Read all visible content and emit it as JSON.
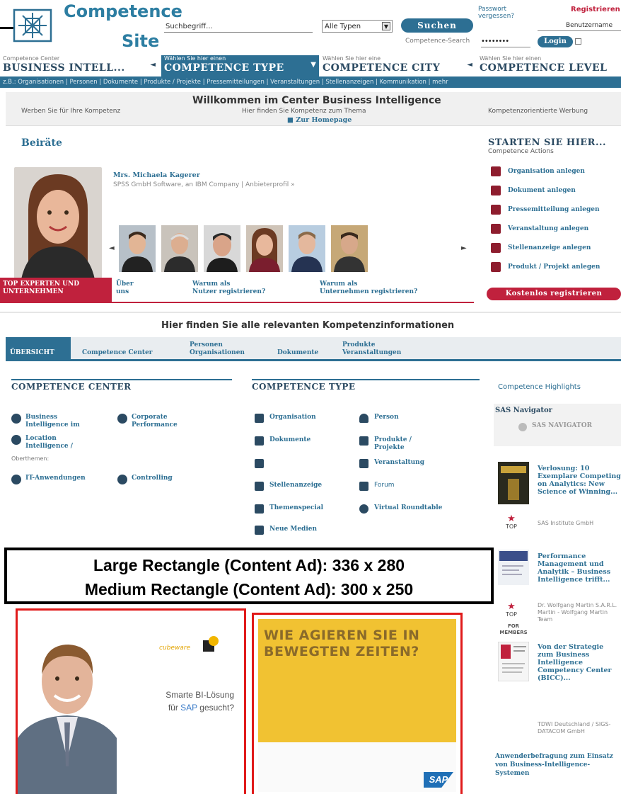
{
  "header": {
    "logo_line1": "Competence",
    "logo_line2": "Site",
    "search_placeholder": "Suchbegriff...",
    "search_type": "Alle Typen",
    "search_button": "Suchen",
    "cs_search_label": "Competence-Search",
    "password_forgot": "Passwort vergessen?",
    "register": "Registrieren",
    "username_placeholder": "Benutzername",
    "password_value": "••••••••",
    "login_button": "Login"
  },
  "selectors": [
    {
      "small": "Competence Center",
      "big": "BUSINESS INTELL..."
    },
    {
      "small": "Wählen Sie hier einen",
      "big": "COMPETENCE TYPE"
    },
    {
      "small": "Wählen Sie hier eine",
      "big": "COMPETENCE CITY"
    },
    {
      "small": "Wählen Sie hier einen",
      "big": "COMPETENCE LEVEL"
    }
  ],
  "category_bar": "z.B.: Organisationen | Personen | Dokumente | Produkte / Projekte | Pressemitteilungen | Veranstaltungen | Stellenanzeigen | Kommunikation | mehr",
  "welcome": {
    "ad_left": "Werben Sie für Ihre Kompetenz",
    "title": "Willkommen im Center Business Intelligence",
    "subtitle": "Hier finden Sie Kompetenz zum Thema",
    "homepage": "Zur Homepage",
    "ad_right": "Kompetenzorientierte Werbung"
  },
  "beirate": {
    "title": "Beiräte",
    "name": "Mrs. Michaela Kagerer",
    "company": "SPSS GmbH Software, an IBM Company  | Anbieterprofil »",
    "promo_top": "TOP EXPERTEN UND UNTERNEHMEN",
    "links": [
      {
        "l1": "Über",
        "l2": "uns"
      },
      {
        "l1": "Warum als",
        "l2": "Nutzer registrieren?"
      },
      {
        "l1": "Warum als",
        "l2": "Unternehmen registrieren?"
      }
    ]
  },
  "start_here": {
    "title": "STARTEN SIE HIER...",
    "subtitle": "Competence Actions",
    "items": [
      "Organisation anlegen",
      "Dokument anlegen",
      "Pressemitteilung anlegen",
      "Veranstaltung anlegen",
      "Stellenanzeige anlegen",
      "Produkt / Projekt anlegen"
    ],
    "register_free": "Kostenlos registrieren"
  },
  "relevant": {
    "title": "Hier finden Sie alle relevanten Kompetenzinformationen",
    "tabs": [
      {
        "l1": "",
        "l2": "ÜBERSICHT"
      },
      {
        "l1": "",
        "l2": "Competence Center"
      },
      {
        "l1": "Personen",
        "l2": "Organisationen"
      },
      {
        "l1": "",
        "l2": "Dokumente"
      },
      {
        "l1": "Produkte",
        "l2": "Veranstaltungen"
      }
    ]
  },
  "competence_center": {
    "title": "COMPETENCE CENTER",
    "items": [
      {
        "l1": "Business",
        "l2": "Intelligence im"
      },
      {
        "l1": "Corporate",
        "l2": "Performance"
      },
      {
        "l1": "Location",
        "l2": "Intelligence /"
      },
      {
        "l1": "IT-Anwendungen",
        "l2": ""
      },
      {
        "l1": "Controlling",
        "l2": ""
      }
    ],
    "overthemes": "Oberthemen:"
  },
  "competence_type": {
    "title": "COMPETENCE TYPE",
    "items": [
      {
        "l1": "Organisation",
        "l2": ""
      },
      {
        "l1": "Person",
        "l2": ""
      },
      {
        "l1": "Dokumente",
        "l2": ""
      },
      {
        "l1": "Produkte /",
        "l2": "Projekte"
      },
      {
        "l1": "",
        "l2": ""
      },
      {
        "l1": "Veranstaltung",
        "l2": ""
      },
      {
        "l1": "Stellenanzeige",
        "l2": ""
      },
      {
        "l1": "Forum",
        "l2": ""
      },
      {
        "l1": "Themenspecial",
        "l2": ""
      },
      {
        "l1": "Virtual Roundtable",
        "l2": ""
      },
      {
        "l1": "Neue Medien",
        "l2": ""
      }
    ]
  },
  "highlights": {
    "title": "Competence Highlights",
    "sas_title": "SAS Navigator",
    "sas_button": "SAS NAVIGATOR",
    "items": [
      {
        "text": "Verlosung: 10 Exemplare Competing on Analytics: New Science of Winning...",
        "author": "SAS Institute GmbH",
        "top": "TOP"
      },
      {
        "text": "Performance Management und Analytik – Business Intelligence trifft...",
        "author": "Dr. Wolfgang Martin S.A.R.L. Martin - Wolfgang Martin Team",
        "top": "TOP"
      },
      {
        "text": "Von der Strategie zum Business Intelligence Competency Center (BICC)...",
        "author": "TDWI Deutschland / SIGS-DATACOM GmbH",
        "top": ""
      }
    ],
    "survey": "Anwenderbefragung zum Einsatz von Business-Intelligence-Systemen",
    "for_members": "FOR MEMBERS"
  },
  "ads": {
    "note_line1": "Large Rectangle (Content Ad): 336 x 280",
    "note_line2": "Medium Rectangle (Content Ad): 300 x 250",
    "large_brand": "cubeware",
    "large_text1": "Smarte BI-Lösung",
    "large_text2a": "für ",
    "large_text2b": "SAP",
    "large_text2c": " gesucht?",
    "medium_text": "WIE AGIEREN SIE IN BEWEGTEN ZEITEN?",
    "medium_logo": "SAP"
  },
  "colors": {
    "brand_blue": "#2d6f93",
    "brand_red": "#c0213d",
    "ad_border": "#e01a1a"
  }
}
